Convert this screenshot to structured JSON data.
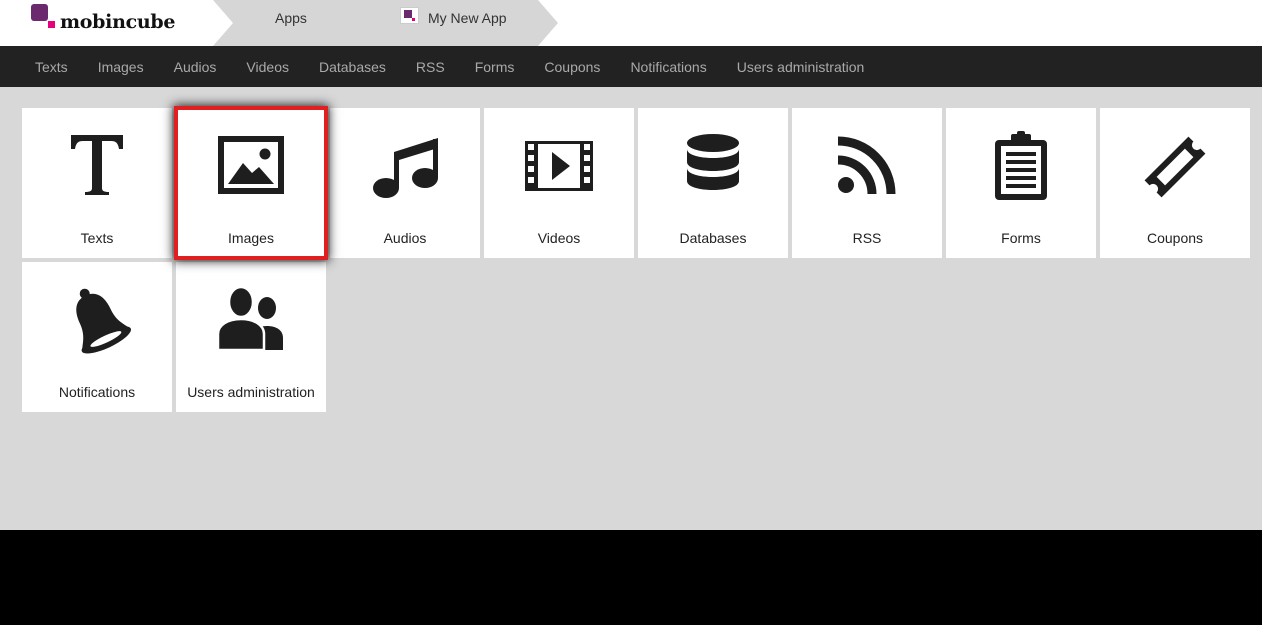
{
  "brand": {
    "name": "mobincube",
    "color": "#6b2a6e",
    "accent": "#e6007e"
  },
  "breadcrumb": {
    "items": [
      {
        "label": "Apps",
        "icon": ""
      },
      {
        "label": "My New App",
        "icon": "app-thumbnail-icon"
      }
    ]
  },
  "nav": {
    "items": [
      "Texts",
      "Images",
      "Audios",
      "Videos",
      "Databases",
      "RSS",
      "Forms",
      "Coupons",
      "Notifications",
      "Users administration"
    ]
  },
  "tiles": [
    {
      "label": "Texts",
      "icon": "text-icon"
    },
    {
      "label": "Images",
      "icon": "image-icon",
      "selected": true
    },
    {
      "label": "Audios",
      "icon": "music-note-icon"
    },
    {
      "label": "Videos",
      "icon": "film-icon"
    },
    {
      "label": "Databases",
      "icon": "database-icon"
    },
    {
      "label": "RSS",
      "icon": "rss-icon"
    },
    {
      "label": "Forms",
      "icon": "clipboard-icon"
    },
    {
      "label": "Coupons",
      "icon": "ticket-icon"
    },
    {
      "label": "Notifications",
      "icon": "bell-icon"
    },
    {
      "label": "Users administration",
      "icon": "users-icon"
    }
  ],
  "colors": {
    "navbar": "#222222",
    "background": "#d8d8d8",
    "highlight": "#e02020"
  }
}
